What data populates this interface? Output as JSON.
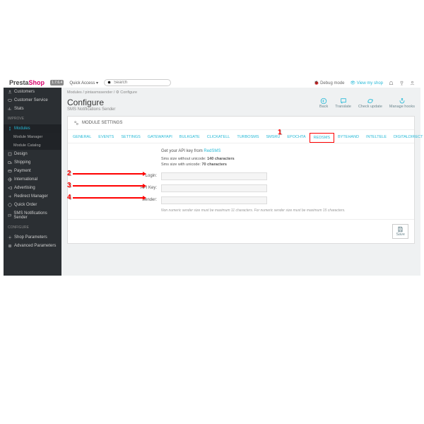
{
  "header": {
    "logo1": "Presta",
    "logo2": "Shop",
    "version": "1.7.6.4",
    "quick_access": "Quick Access",
    "search_placeholder": "Search",
    "debug": "Debug mode",
    "view_shop": "View my shop"
  },
  "sidebar": {
    "sell": [
      "Customers",
      "Customer Service",
      "Stats"
    ],
    "sections": [
      "Improve",
      "Configure"
    ],
    "improve": [
      "Modules",
      "Design",
      "Shipping",
      "Payment",
      "International",
      "Advertising",
      "Redirect Manager",
      "Quick Order",
      "SMS Notifications Sender"
    ],
    "modules_sub": [
      "Module Manager",
      "Module Catalog"
    ],
    "configure": [
      "Shop Parameters",
      "Advanced Parameters"
    ]
  },
  "breadcrumb": [
    "Modules",
    "pintasmssender",
    "Configure"
  ],
  "page": {
    "title": "Configure",
    "subtitle": "SMS Notifications Sender"
  },
  "actions": [
    "Back",
    "Translate",
    "Check update",
    "Manage hooks"
  ],
  "panel": {
    "title": "MODULE SETTINGS"
  },
  "tabs": [
    "GENERAL",
    "EVENTS",
    "SETTINGS",
    "GATEWAYAPI",
    "BULKGATE",
    "CLICKATELL",
    "TURBOSMS",
    "SMSRU",
    "EPOCHTA",
    "REDSMS",
    "BYTEHAND",
    "INTELTELE",
    "DIGITALDIRECT"
  ],
  "form": {
    "hint_pre": "Get your API key from",
    "hint_link": "RedSMS",
    "limit1a": "Sms size without unicode:",
    "limit1b": "140 characters",
    "limit2a": "Sms size with unicode:",
    "limit2b": "70 characters",
    "fields": [
      {
        "label": "Login:"
      },
      {
        "label": "API Key:"
      },
      {
        "label": "Sender:"
      }
    ],
    "sender_note": "Non numeric sender size must be maximum 11 characters. For numeric sender size must be maximum 15 characters.",
    "save": "Save"
  },
  "callouts": [
    "1",
    "2",
    "3",
    "4"
  ]
}
